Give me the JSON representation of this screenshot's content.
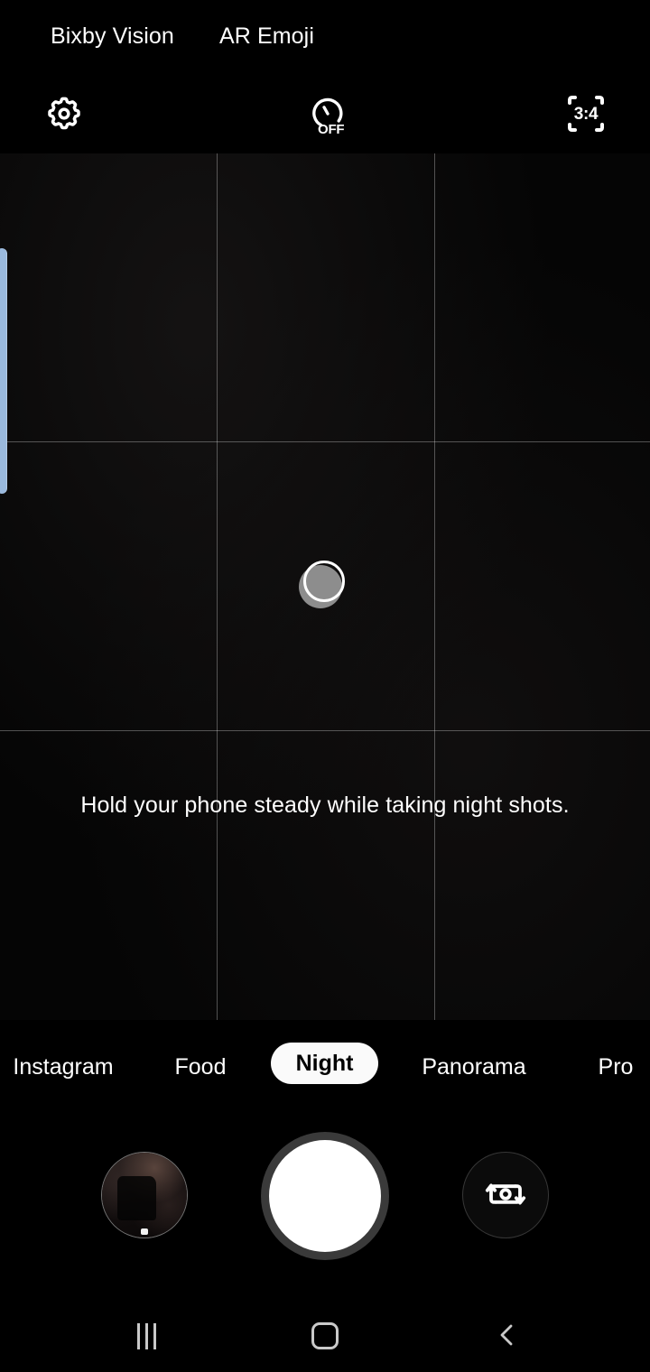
{
  "app": {
    "name": "Camera",
    "mode": "Night"
  },
  "top_shortcuts": [
    {
      "id": "bixby-vision",
      "label": "Bixby Vision"
    },
    {
      "id": "ar-emoji",
      "label": "AR Emoji"
    }
  ],
  "top_bar": {
    "settings": {
      "icon": "gear-icon",
      "label": "Settings"
    },
    "timer": {
      "icon": "timer-icon",
      "value": "OFF",
      "label": "Timer"
    },
    "aspect_ratio": {
      "icon": "aspect-ratio-icon",
      "value": "3:4",
      "label": "Aspect ratio"
    }
  },
  "viewfinder": {
    "hint": "Hold your phone steady while taking night shots.",
    "grid": "on",
    "focus_indicator": "af-focus-circle"
  },
  "edge_panel": {
    "handle_label": "Edge panel handle",
    "color": "#9ab9dd"
  },
  "mode_selector": {
    "modes": [
      {
        "label": "Instagram",
        "selected": false
      },
      {
        "label": "Food",
        "selected": false
      },
      {
        "label": "Night",
        "selected": true
      },
      {
        "label": "Panorama",
        "selected": false
      },
      {
        "label": "Pro",
        "selected": false
      }
    ]
  },
  "bottom_controls": {
    "gallery": {
      "label": "Gallery",
      "icon": "gallery-thumbnail"
    },
    "shutter": {
      "label": "Take picture",
      "icon": "shutter-icon"
    },
    "switch_camera": {
      "label": "Switch camera",
      "icon": "switch-camera-icon"
    }
  },
  "nav_bar": {
    "recents": {
      "label": "Recents",
      "icon": "recents-icon"
    },
    "home": {
      "label": "Home",
      "icon": "home-icon"
    },
    "back": {
      "label": "Back",
      "icon": "back-chevron-icon"
    }
  },
  "colors": {
    "background": "#000000",
    "accent_selected": "#fafafa",
    "shutter_ring": "#3a3a3a",
    "edge_handle": "#9ab9dd",
    "nav_icon": "#c9c9c9"
  }
}
